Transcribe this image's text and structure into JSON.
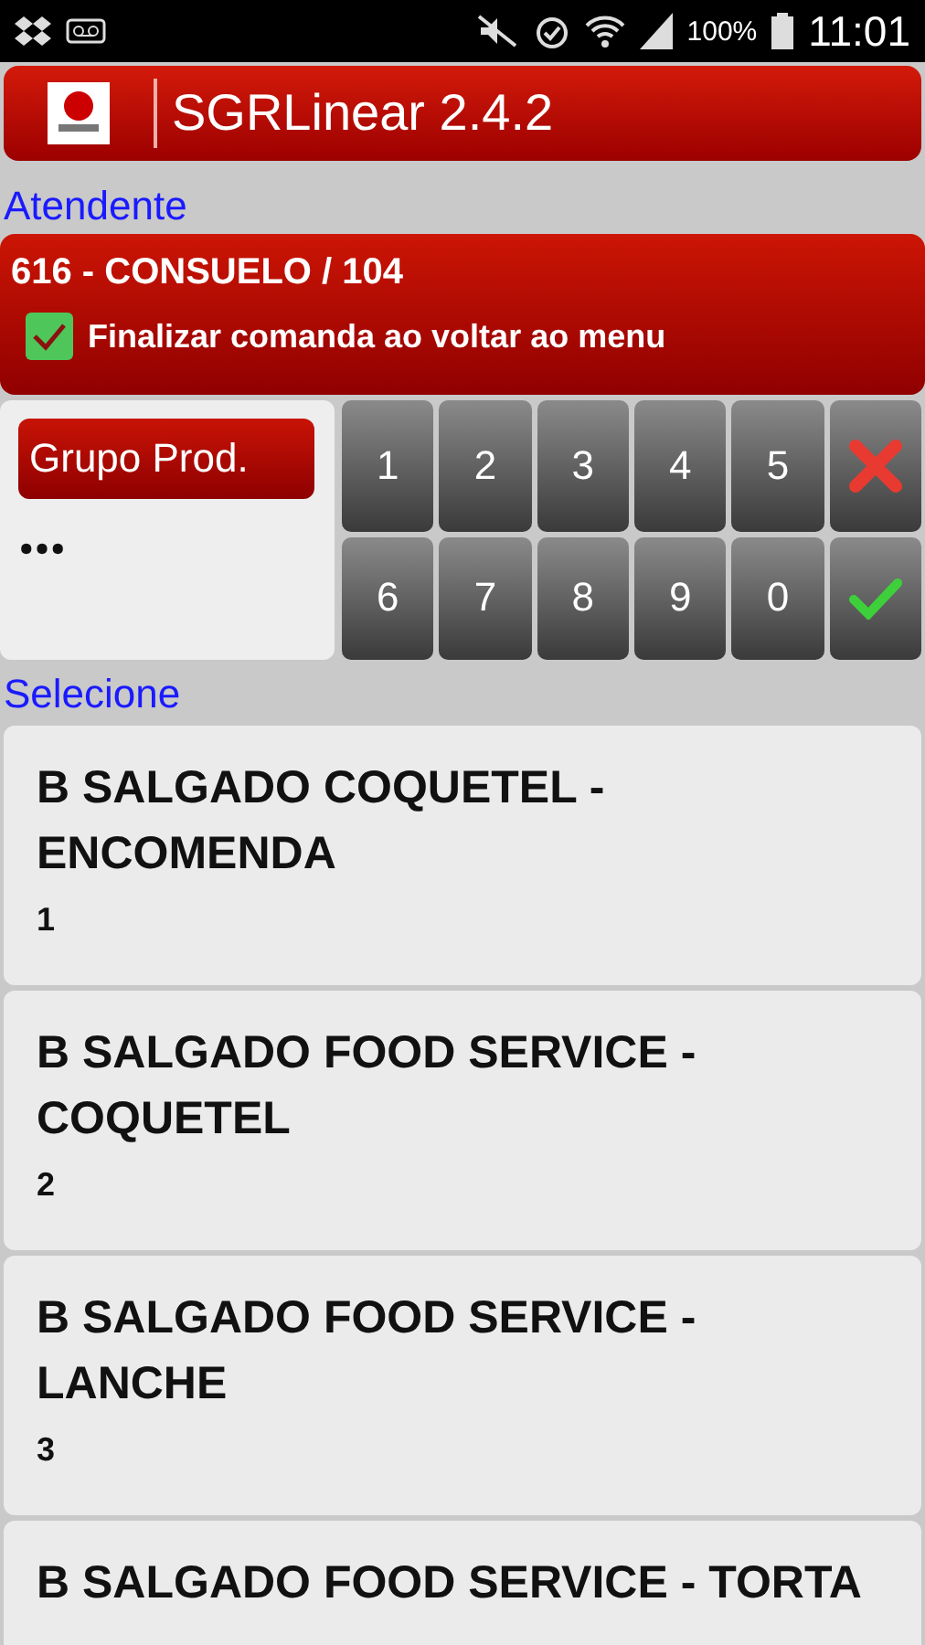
{
  "status_bar": {
    "battery": "100%",
    "time": "11:01"
  },
  "app_bar": {
    "title": "SGRLinear 2.4.2"
  },
  "attendant": {
    "label": "Atendente",
    "name": "616 - CONSUELO / 104",
    "finalize": {
      "label": "Finalizar comanda ao voltar ao menu",
      "checked": true
    }
  },
  "group": {
    "button": "Grupo Prod.",
    "value": "•••"
  },
  "keypad": [
    {
      "kind": "digit",
      "label": "1"
    },
    {
      "kind": "digit",
      "label": "2"
    },
    {
      "kind": "digit",
      "label": "3"
    },
    {
      "kind": "digit",
      "label": "4"
    },
    {
      "kind": "digit",
      "label": "5"
    },
    {
      "kind": "cancel"
    },
    {
      "kind": "digit",
      "label": "6"
    },
    {
      "kind": "digit",
      "label": "7"
    },
    {
      "kind": "digit",
      "label": "8"
    },
    {
      "kind": "digit",
      "label": "9"
    },
    {
      "kind": "digit",
      "label": "0"
    },
    {
      "kind": "confirm"
    }
  ],
  "select_label": "Selecione",
  "items": [
    {
      "title": "B SALGADO COQUETEL - ENCOMENDA",
      "code": "1"
    },
    {
      "title": "B SALGADO FOOD SERVICE - COQUETEL",
      "code": "2"
    },
    {
      "title": "B SALGADO FOOD SERVICE - LANCHE",
      "code": "3"
    },
    {
      "title": "B SALGADO FOOD SERVICE - TORTA"
    }
  ]
}
